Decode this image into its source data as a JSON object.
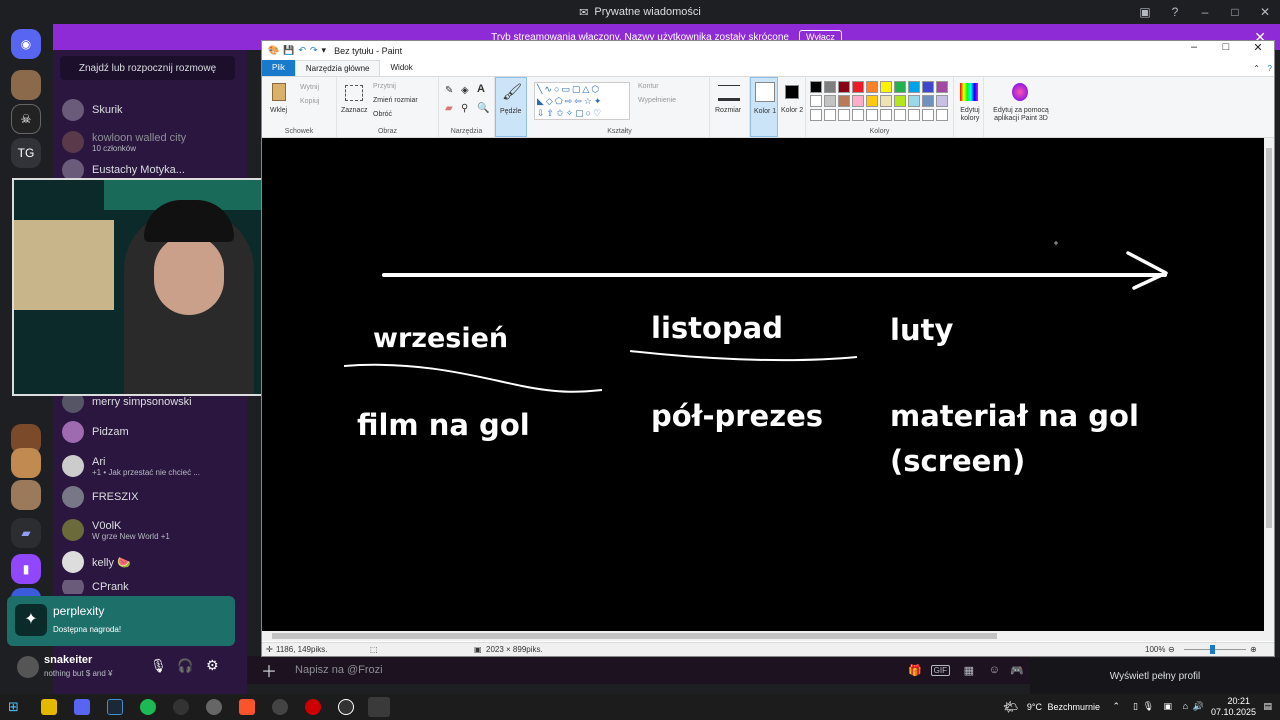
{
  "discord": {
    "title": "Prywatne wiadomości",
    "notice_text": "Tryb streamowania włączony. Nazwy użytkownika zostały skrócone",
    "notice_button": "Wyłącz",
    "search_label": "Znajdź lub rozpocznij rozmowę",
    "guild_tg": "TG",
    "dms": [
      {
        "name": "Skurik",
        "sub": ""
      },
      {
        "name": "kowloon walled city",
        "sub": "10 członków"
      },
      {
        "name": "Eustachy Motyka...",
        "sub": ""
      },
      {
        "name": "merry simpsonowski",
        "sub": ""
      },
      {
        "name": "Pidzam",
        "sub": ""
      },
      {
        "name": "Ari",
        "sub": "+1 • Jak przestać nie chcieć ..."
      },
      {
        "name": "FRESZIX",
        "sub": ""
      },
      {
        "name": "V0olK",
        "sub": "W grze New World +1"
      },
      {
        "name": "kelly 🍉",
        "sub": ""
      },
      {
        "name": "CPrank",
        "sub": ""
      }
    ],
    "promo": {
      "title": "perplexity",
      "sub": "Dostępna nagroda!"
    },
    "user": {
      "name": "snakeiter",
      "status": "nothing but $ and ¥"
    },
    "chat_placeholder": "Napisz na @Frozi",
    "profile_button": "Wyświetl pełny profil"
  },
  "paint": {
    "title": "Bez tytułu - Paint",
    "tabs": [
      "Plik",
      "Narzędzia główne",
      "Widok"
    ],
    "ribbon": {
      "clipboard": {
        "paste": "Wklej",
        "cut": "Wytnij",
        "copy": "Kopiuj",
        "label": "Schowek"
      },
      "image": {
        "select": "Zaznacz",
        "crop": "Przytnij",
        "resize": "Zmień rozmiar",
        "rotate": "Obróć",
        "label": "Obraz"
      },
      "tools": {
        "label": "Narzędzia"
      },
      "brushes": {
        "label": "Pędzle"
      },
      "shapes": {
        "outline": "Kontur",
        "fill": "Wypełnienie",
        "label": "Kształty"
      },
      "size": {
        "label": "Rozmiar"
      },
      "color1": "Kolor 1",
      "color2": "Kolor 2",
      "colors_label": "Kolory",
      "edit_colors": "Edytuj kolory",
      "paint3d": "Edytuj za pomocą aplikacji Paint 3D"
    },
    "palette": [
      "#000000",
      "#7f7f7f",
      "#880015",
      "#ed1c24",
      "#ff7f27",
      "#fff200",
      "#22b14c",
      "#00a2e8",
      "#3f48cc",
      "#a349a4",
      "#ffffff",
      "#c3c3c3",
      "#b97a57",
      "#ffaec9",
      "#ffc90e",
      "#efe4b0",
      "#b5e61d",
      "#99d9ea",
      "#7092be",
      "#c8bfe7"
    ],
    "canvas_text": {
      "month1": "wrzesień",
      "month2": "listopad",
      "month3": "luty",
      "item1": "film na gol",
      "item2": "pół-prezes",
      "item3a": "materiał na gol",
      "item3b": "(screen)"
    },
    "status": {
      "cursor": "1186, 149piks.",
      "size": "2023 × 899piks.",
      "zoom": "100%"
    }
  },
  "taskbar": {
    "weather_temp": "9°C",
    "weather_text": "Bezchmurnie",
    "time": "20:21",
    "date": "07.10.2025"
  }
}
